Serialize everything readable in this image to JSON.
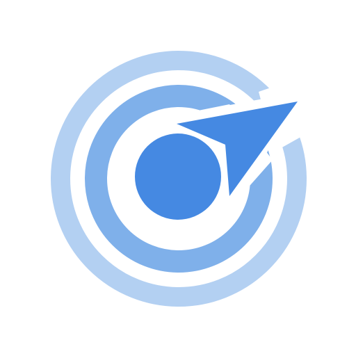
{
  "logo": {
    "icon": "target-compass-logo-icon",
    "colors": {
      "outer_ring": "#b3d0f2",
      "inner_ring": "#7fb0ea",
      "core": "#4589e2",
      "pointer": "#4589e2",
      "background": "#ffffff"
    }
  }
}
